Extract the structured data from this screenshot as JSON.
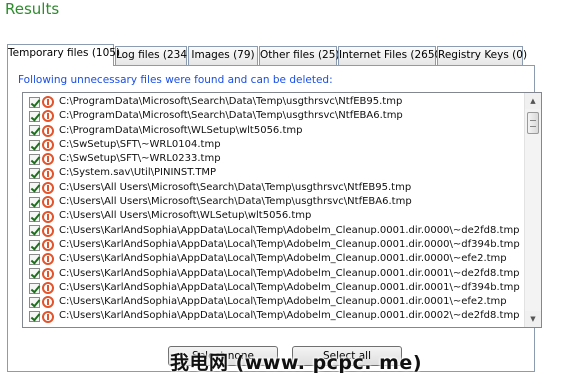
{
  "title": "Results",
  "tabs": [
    {
      "label": "Temporary files (105)",
      "active": true
    },
    {
      "label": "Log files (234)",
      "active": false
    },
    {
      "label": "Images (79)",
      "active": false
    },
    {
      "label": "Other files (25)",
      "active": false
    },
    {
      "label": "Internet Files (2650)",
      "active": false
    },
    {
      "label": "Registry Keys (0)",
      "active": false
    }
  ],
  "notice": "Following unnecessary files were found and can be deleted:",
  "files": [
    "C:\\ProgramData\\Microsoft\\Search\\Data\\Temp\\usgthrsvc\\NtfEB95.tmp",
    "C:\\ProgramData\\Microsoft\\Search\\Data\\Temp\\usgthrsvc\\NtfEBA6.tmp",
    "C:\\ProgramData\\Microsoft\\WLSetup\\wlt5056.tmp",
    "C:\\SwSetup\\SFT\\~WRL0104.tmp",
    "C:\\SwSetup\\SFT\\~WRL0233.tmp",
    "C:\\System.sav\\Util\\PININST.TMP",
    "C:\\Users\\All Users\\Microsoft\\Search\\Data\\Temp\\usgthrsvc\\NtfEB95.tmp",
    "C:\\Users\\All Users\\Microsoft\\Search\\Data\\Temp\\usgthrsvc\\NtfEBA6.tmp",
    "C:\\Users\\All Users\\Microsoft\\WLSetup\\wlt5056.tmp",
    "C:\\Users\\KarlAndSophia\\AppData\\Local\\Temp\\Adobelm_Cleanup.0001.dir.0000\\~de2fd8.tmp",
    "C:\\Users\\KarlAndSophia\\AppData\\Local\\Temp\\Adobelm_Cleanup.0001.dir.0000\\~df394b.tmp",
    "C:\\Users\\KarlAndSophia\\AppData\\Local\\Temp\\Adobelm_Cleanup.0001.dir.0000\\~efe2.tmp",
    "C:\\Users\\KarlAndSophia\\AppData\\Local\\Temp\\Adobelm_Cleanup.0001.dir.0001\\~de2fd8.tmp",
    "C:\\Users\\KarlAndSophia\\AppData\\Local\\Temp\\Adobelm_Cleanup.0001.dir.0001\\~df394b.tmp",
    "C:\\Users\\KarlAndSophia\\AppData\\Local\\Temp\\Adobelm_Cleanup.0001.dir.0001\\~efe2.tmp",
    "C:\\Users\\KarlAndSophia\\AppData\\Local\\Temp\\Adobelm_Cleanup.0001.dir.0002\\~de2fd8.tmp"
  ],
  "buttons": {
    "select_none": "Select none",
    "select_all": "Select all"
  },
  "watermark": "我电网 (www. pcpc. me)",
  "colors": {
    "title": "#2e8b2e",
    "notice": "#1a4ee6",
    "delete_icon": "#e2542c"
  }
}
